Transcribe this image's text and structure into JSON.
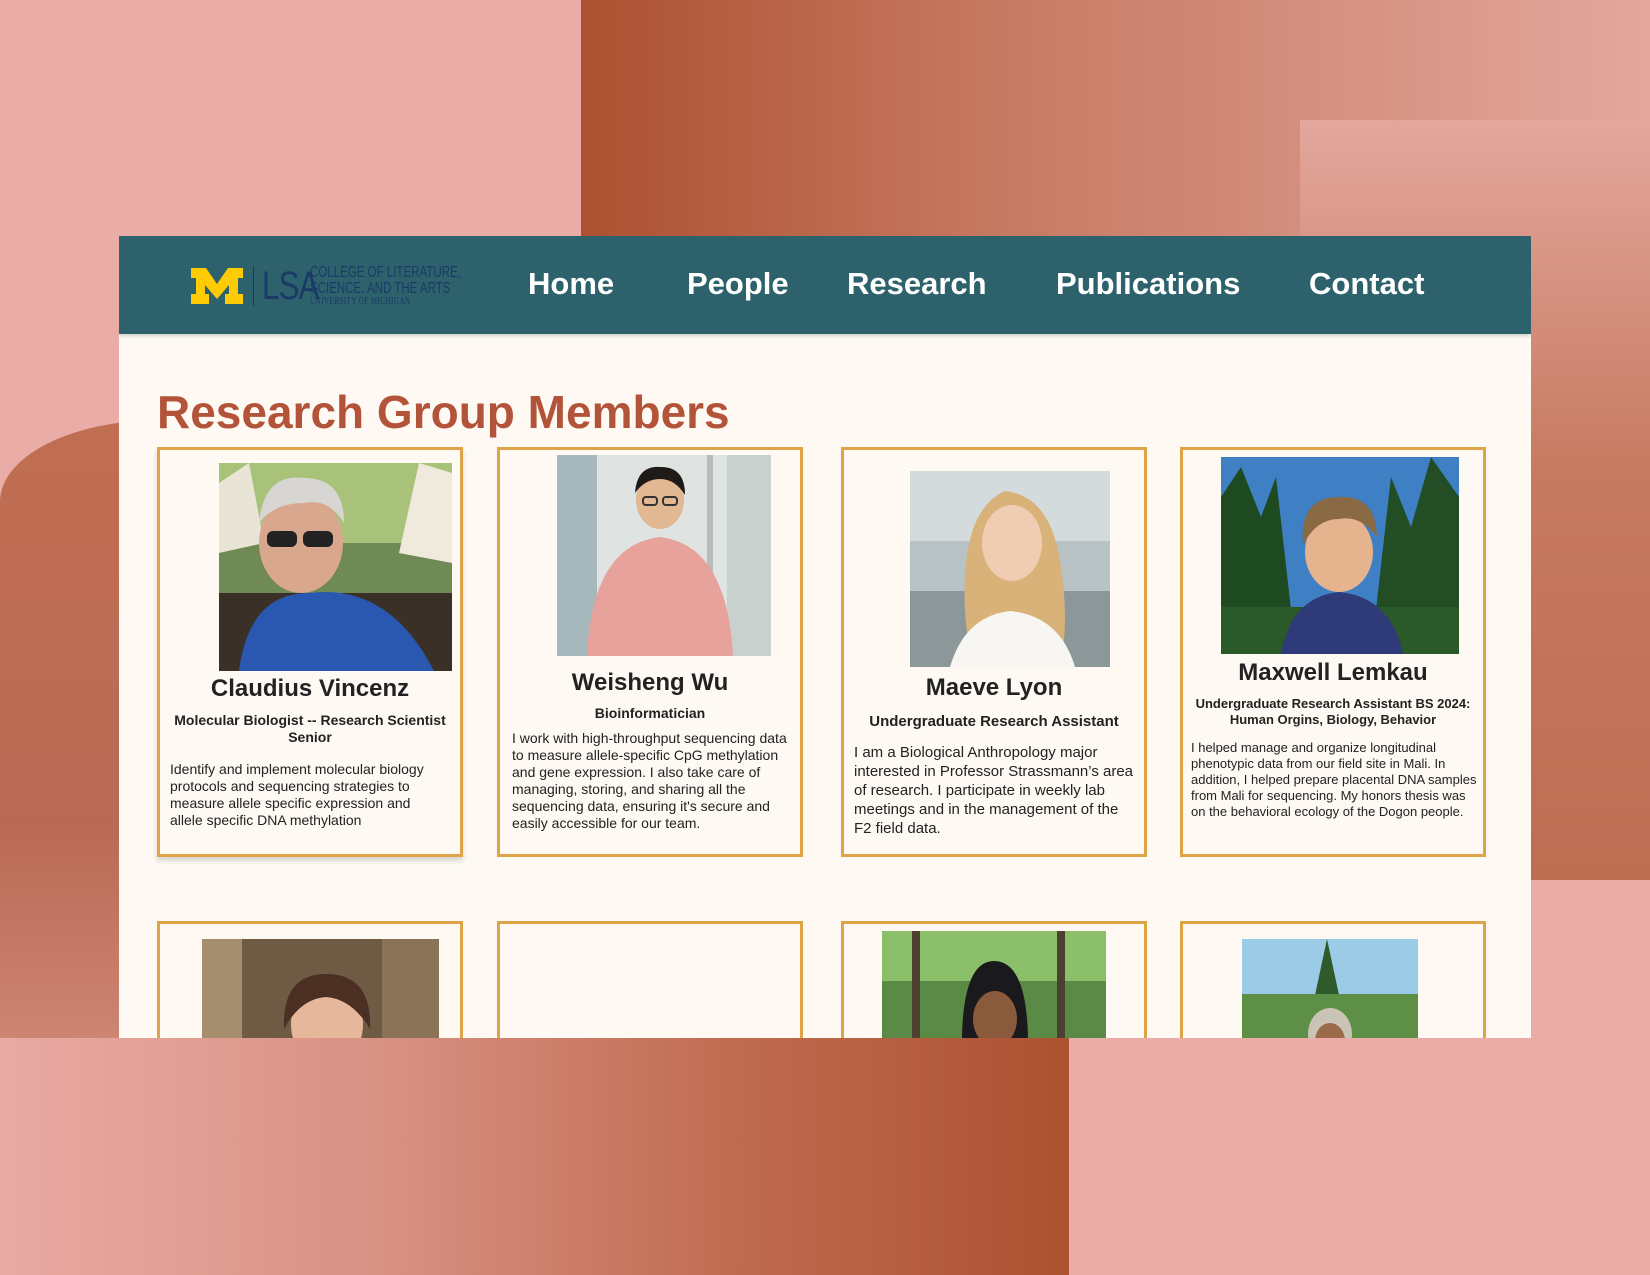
{
  "brand": {
    "block_m": "M",
    "lsa": "LSA",
    "college_line1": "COLLEGE OF LITERATURE,",
    "college_line2": "SCIENCE, AND THE ARTS",
    "university": "UNIVERSITY OF MICHIGAN",
    "maize": "#ffcb05",
    "blue": "#1b3a66"
  },
  "nav": {
    "items": [
      {
        "label": "Home"
      },
      {
        "label": "People"
      },
      {
        "label": "Research"
      },
      {
        "label": "Publications"
      },
      {
        "label": "Contact"
      }
    ]
  },
  "page": {
    "title": "Research Group Members"
  },
  "members": [
    {
      "name": "Claudius Vincenz",
      "role": "Molecular Biologist -- Research Scientist Senior",
      "bio": "Identify and implement molecular biology protocols and sequencing strategies to measure allele specific expression and allele specific DNA methylation"
    },
    {
      "name": "Weisheng  Wu",
      "role": "Bioinformatician",
      "bio": "I work with high-throughput sequencing data to measure allele-specific CpG methylation and gene expression. I also take care of managing, storing, and sharing all the sequencing data, ensuring it's secure and easily accessible for our team."
    },
    {
      "name": "Maeve Lyon",
      "role": "Undergraduate Research Assistant",
      "bio": "I am a Biological Anthropology major interested in Professor Strassmann’s area of research.  I participate in weekly lab meetings and in the management of the F2 field data."
    },
    {
      "name": "Maxwell Lemkau",
      "role": "Undergraduate Research Assistant BS 2024:  Human Orgins, Biology, Behavior",
      "bio": "I helped manage and organize longitudinal phenotypic data from our field site in Mali. In addition, I helped prepare placental DNA samples from Mali for sequencing. My honors thesis was on the behavioral ecology of the Dogon people."
    }
  ],
  "colors": {
    "nav_bg": "#2d626c",
    "heading": "#b3543a",
    "card_border": "#dda547",
    "page_bg": "#fefaf3"
  }
}
